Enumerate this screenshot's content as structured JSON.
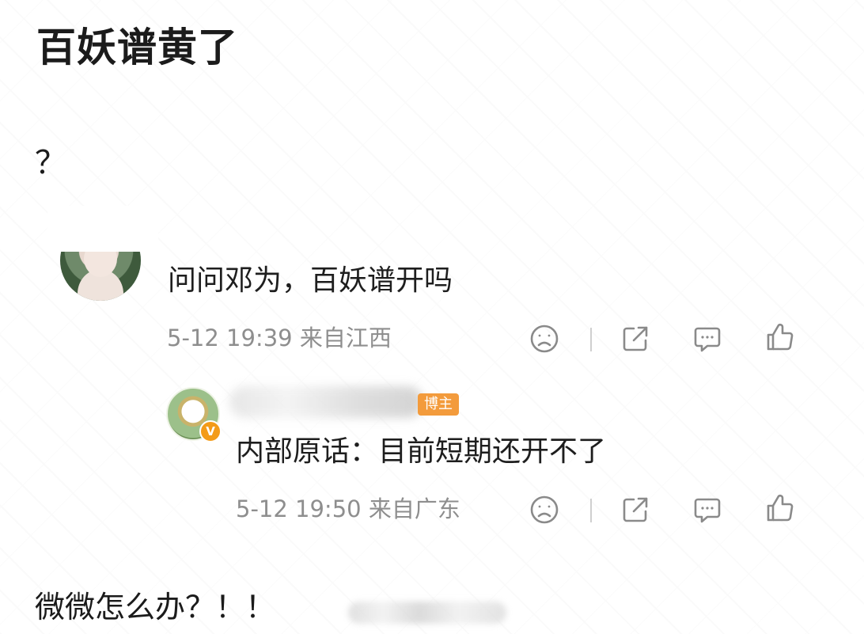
{
  "post": {
    "title": "百妖谱黄了",
    "body": "？",
    "footer": "微微怎么办？！！"
  },
  "comments": [
    {
      "text": "问问邓为，百妖谱开吗",
      "time": "5-12 19:39",
      "location": "来自江西"
    },
    {
      "author_tag": "博主",
      "verified_badge": "V",
      "text": "内部原话：目前短期还开不了",
      "time": "5-12 19:50",
      "location": "来自广东"
    }
  ],
  "icons": {
    "dislike": "sad-face-icon",
    "share": "share-icon",
    "comment": "comment-icon",
    "like": "thumbs-up-icon"
  },
  "colors": {
    "meta_gray": "#8e8e8e",
    "author_tag": "#f39b3c",
    "verified": "#f39b18"
  }
}
